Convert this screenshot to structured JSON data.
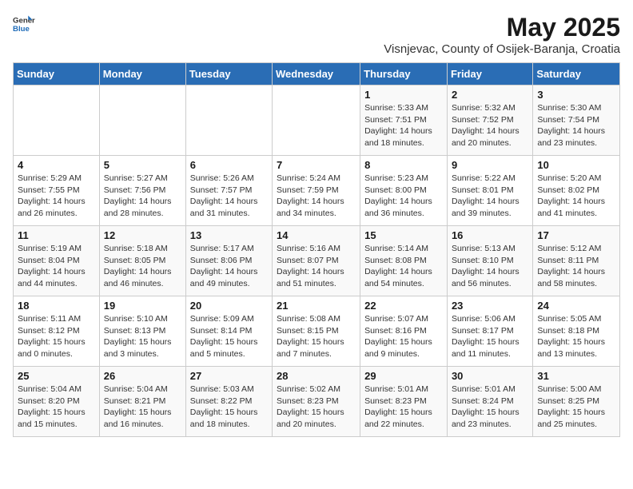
{
  "logo": {
    "general": "General",
    "blue": "Blue"
  },
  "title": "May 2025",
  "subtitle": "Visnjevac, County of Osijek-Baranja, Croatia",
  "days_of_week": [
    "Sunday",
    "Monday",
    "Tuesday",
    "Wednesday",
    "Thursday",
    "Friday",
    "Saturday"
  ],
  "weeks": [
    [
      {
        "day": "",
        "info": ""
      },
      {
        "day": "",
        "info": ""
      },
      {
        "day": "",
        "info": ""
      },
      {
        "day": "",
        "info": ""
      },
      {
        "day": "1",
        "info": "Sunrise: 5:33 AM\nSunset: 7:51 PM\nDaylight: 14 hours\nand 18 minutes."
      },
      {
        "day": "2",
        "info": "Sunrise: 5:32 AM\nSunset: 7:52 PM\nDaylight: 14 hours\nand 20 minutes."
      },
      {
        "day": "3",
        "info": "Sunrise: 5:30 AM\nSunset: 7:54 PM\nDaylight: 14 hours\nand 23 minutes."
      }
    ],
    [
      {
        "day": "4",
        "info": "Sunrise: 5:29 AM\nSunset: 7:55 PM\nDaylight: 14 hours\nand 26 minutes."
      },
      {
        "day": "5",
        "info": "Sunrise: 5:27 AM\nSunset: 7:56 PM\nDaylight: 14 hours\nand 28 minutes."
      },
      {
        "day": "6",
        "info": "Sunrise: 5:26 AM\nSunset: 7:57 PM\nDaylight: 14 hours\nand 31 minutes."
      },
      {
        "day": "7",
        "info": "Sunrise: 5:24 AM\nSunset: 7:59 PM\nDaylight: 14 hours\nand 34 minutes."
      },
      {
        "day": "8",
        "info": "Sunrise: 5:23 AM\nSunset: 8:00 PM\nDaylight: 14 hours\nand 36 minutes."
      },
      {
        "day": "9",
        "info": "Sunrise: 5:22 AM\nSunset: 8:01 PM\nDaylight: 14 hours\nand 39 minutes."
      },
      {
        "day": "10",
        "info": "Sunrise: 5:20 AM\nSunset: 8:02 PM\nDaylight: 14 hours\nand 41 minutes."
      }
    ],
    [
      {
        "day": "11",
        "info": "Sunrise: 5:19 AM\nSunset: 8:04 PM\nDaylight: 14 hours\nand 44 minutes."
      },
      {
        "day": "12",
        "info": "Sunrise: 5:18 AM\nSunset: 8:05 PM\nDaylight: 14 hours\nand 46 minutes."
      },
      {
        "day": "13",
        "info": "Sunrise: 5:17 AM\nSunset: 8:06 PM\nDaylight: 14 hours\nand 49 minutes."
      },
      {
        "day": "14",
        "info": "Sunrise: 5:16 AM\nSunset: 8:07 PM\nDaylight: 14 hours\nand 51 minutes."
      },
      {
        "day": "15",
        "info": "Sunrise: 5:14 AM\nSunset: 8:08 PM\nDaylight: 14 hours\nand 54 minutes."
      },
      {
        "day": "16",
        "info": "Sunrise: 5:13 AM\nSunset: 8:10 PM\nDaylight: 14 hours\nand 56 minutes."
      },
      {
        "day": "17",
        "info": "Sunrise: 5:12 AM\nSunset: 8:11 PM\nDaylight: 14 hours\nand 58 minutes."
      }
    ],
    [
      {
        "day": "18",
        "info": "Sunrise: 5:11 AM\nSunset: 8:12 PM\nDaylight: 15 hours\nand 0 minutes."
      },
      {
        "day": "19",
        "info": "Sunrise: 5:10 AM\nSunset: 8:13 PM\nDaylight: 15 hours\nand 3 minutes."
      },
      {
        "day": "20",
        "info": "Sunrise: 5:09 AM\nSunset: 8:14 PM\nDaylight: 15 hours\nand 5 minutes."
      },
      {
        "day": "21",
        "info": "Sunrise: 5:08 AM\nSunset: 8:15 PM\nDaylight: 15 hours\nand 7 minutes."
      },
      {
        "day": "22",
        "info": "Sunrise: 5:07 AM\nSunset: 8:16 PM\nDaylight: 15 hours\nand 9 minutes."
      },
      {
        "day": "23",
        "info": "Sunrise: 5:06 AM\nSunset: 8:17 PM\nDaylight: 15 hours\nand 11 minutes."
      },
      {
        "day": "24",
        "info": "Sunrise: 5:05 AM\nSunset: 8:18 PM\nDaylight: 15 hours\nand 13 minutes."
      }
    ],
    [
      {
        "day": "25",
        "info": "Sunrise: 5:04 AM\nSunset: 8:20 PM\nDaylight: 15 hours\nand 15 minutes."
      },
      {
        "day": "26",
        "info": "Sunrise: 5:04 AM\nSunset: 8:21 PM\nDaylight: 15 hours\nand 16 minutes."
      },
      {
        "day": "27",
        "info": "Sunrise: 5:03 AM\nSunset: 8:22 PM\nDaylight: 15 hours\nand 18 minutes."
      },
      {
        "day": "28",
        "info": "Sunrise: 5:02 AM\nSunset: 8:23 PM\nDaylight: 15 hours\nand 20 minutes."
      },
      {
        "day": "29",
        "info": "Sunrise: 5:01 AM\nSunset: 8:23 PM\nDaylight: 15 hours\nand 22 minutes."
      },
      {
        "day": "30",
        "info": "Sunrise: 5:01 AM\nSunset: 8:24 PM\nDaylight: 15 hours\nand 23 minutes."
      },
      {
        "day": "31",
        "info": "Sunrise: 5:00 AM\nSunset: 8:25 PM\nDaylight: 15 hours\nand 25 minutes."
      }
    ]
  ]
}
